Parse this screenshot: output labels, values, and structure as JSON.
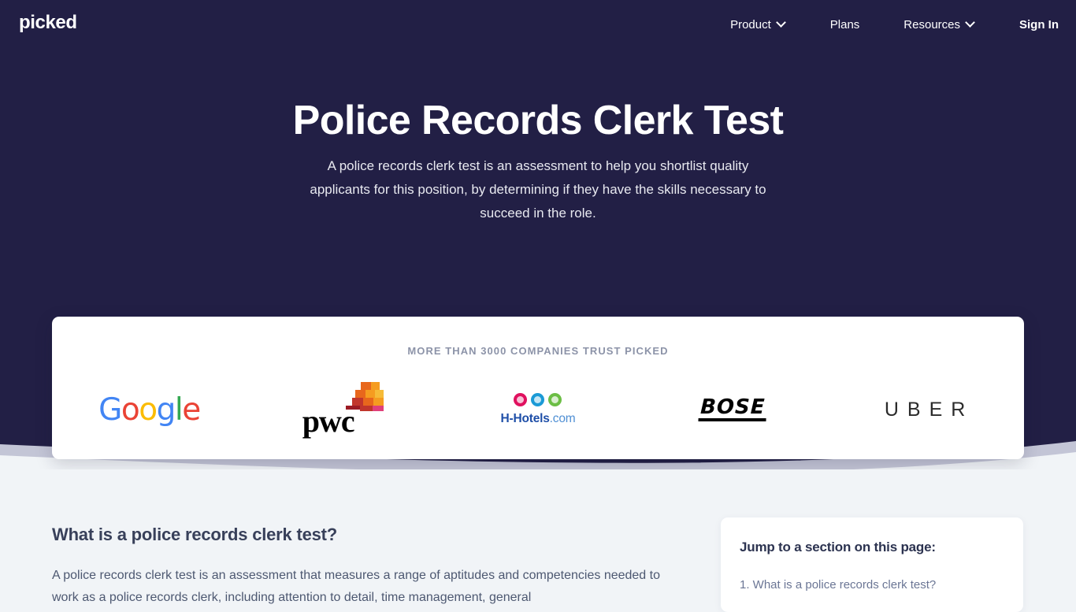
{
  "brand": {
    "name": "picked"
  },
  "nav": {
    "items": [
      {
        "label": "Product",
        "has_chevron": true,
        "icon": "chevron-down-icon"
      },
      {
        "label": "Plans",
        "has_chevron": false
      },
      {
        "label": "Resources",
        "has_chevron": true,
        "icon": "chevron-down-icon"
      },
      {
        "label": "Sign In",
        "has_chevron": false
      }
    ]
  },
  "hero": {
    "title": "Police Records Clerk Test",
    "subtitle": "A police records clerk test is an assessment to help you shortlist quality applicants for this position, by determining if they have the skills necessary to succeed in the role.",
    "background_color": "#221f45"
  },
  "trust": {
    "label": "MORE THAN 3000 COMPANIES TRUST PICKED",
    "logos": [
      {
        "name": "Google",
        "letters": [
          "G",
          "o",
          "o",
          "g",
          "l",
          "e"
        ]
      },
      {
        "name": "pwc",
        "wordmark": "pwc"
      },
      {
        "name": "H-Hotels.com",
        "wordmark": "H-Hotels",
        "suffix": ".com"
      },
      {
        "name": "BOSE",
        "wordmark": "BOSE"
      },
      {
        "name": "UBER",
        "wordmark": "UBER"
      }
    ]
  },
  "article": {
    "heading": "What is a police records clerk test?",
    "paragraph": "A police records clerk test is an assessment that measures a range of aptitudes and competencies needed to work as a police records clerk, including attention to detail, time management, general"
  },
  "toc": {
    "title": "Jump to a section on this page:",
    "items": [
      {
        "label": "1. What is a police records clerk test?"
      }
    ]
  },
  "colors": {
    "navy": "#221f45",
    "page_bg": "#f1f4f7",
    "wave_light": "#c3c5d6",
    "google_blue": "#4285F4",
    "google_red": "#EA4335",
    "google_yellow": "#FBBC05",
    "google_green": "#34A853",
    "hh_blue": "#1f4fa8"
  }
}
